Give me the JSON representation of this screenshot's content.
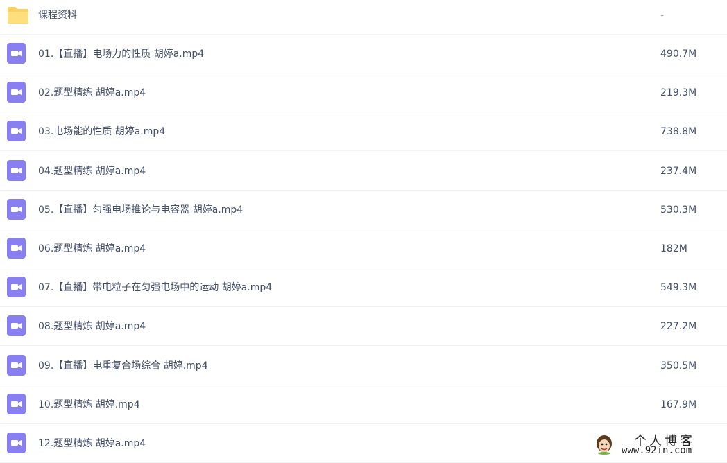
{
  "colors": {
    "video_icon": "#8a7ff0",
    "folder_icon": "#ffd15c",
    "text": "#424e67",
    "divider": "#f1f2f4"
  },
  "folder": {
    "name": "课程资料",
    "size": "-",
    "icon": "folder-icon"
  },
  "files": [
    {
      "name": "01.【直播】电场力的性质 胡婷a.mp4",
      "size": "490.7M",
      "icon": "video-icon"
    },
    {
      "name": "02.题型精练 胡婷a.mp4",
      "size": "219.3M",
      "icon": "video-icon"
    },
    {
      "name": "03.电场能的性质 胡婷a.mp4",
      "size": "738.8M",
      "icon": "video-icon"
    },
    {
      "name": "04.题型精练 胡婷a.mp4",
      "size": "237.4M",
      "icon": "video-icon"
    },
    {
      "name": "05.【直播】匀强电场推论与电容器 胡婷a.mp4",
      "size": "530.3M",
      "icon": "video-icon"
    },
    {
      "name": "06.题型精炼 胡婷a.mp4",
      "size": "182M",
      "icon": "video-icon"
    },
    {
      "name": "07.【直播】带电粒子在匀强电场中的运动 胡婷a.mp4",
      "size": "549.3M",
      "icon": "video-icon"
    },
    {
      "name": "08.题型精炼 胡婷a.mp4",
      "size": "227.2M",
      "icon": "video-icon"
    },
    {
      "name": "09.【直播】电重复合场综合 胡婷.mp4",
      "size": "350.5M",
      "icon": "video-icon"
    },
    {
      "name": "10.题型精炼 胡婷.mp4",
      "size": "167.9M",
      "icon": "video-icon"
    },
    {
      "name": "12.题型精炼 胡婷a.mp4",
      "size": "",
      "icon": "video-icon"
    }
  ],
  "watermark": {
    "title": "个人博客",
    "url": "www.92in.com"
  }
}
